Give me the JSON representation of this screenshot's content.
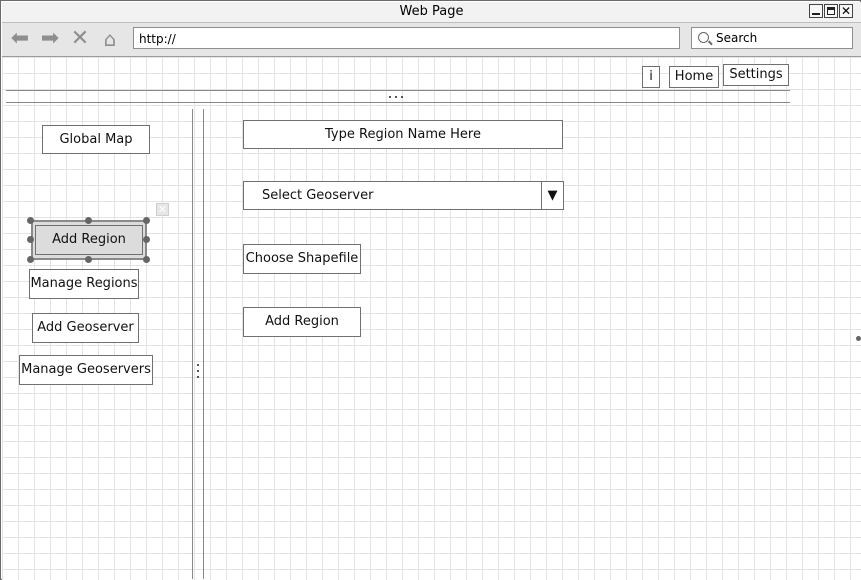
{
  "window": {
    "title": "Web Page"
  },
  "toolbar": {
    "url": "http://",
    "search_placeholder": "Search",
    "icons": [
      "back-icon",
      "forward-icon",
      "stop-icon",
      "home-icon"
    ]
  },
  "topnav": {
    "info": "i",
    "home": "Home",
    "settings": "Settings"
  },
  "sidebar": {
    "global_map": "Global Map",
    "add_region": "Add Region",
    "manage_regions": "Manage Regions",
    "add_geoserver": "Add Geoserver",
    "manage_geoservers": "Manage Geoservers"
  },
  "form": {
    "region_name": "Type Region Name Here",
    "select_geoserver": "Select Geoserver",
    "dropdown_arrow": "▼",
    "choose_shapefile": "Choose Shapefile",
    "add_region": "Add Region"
  }
}
